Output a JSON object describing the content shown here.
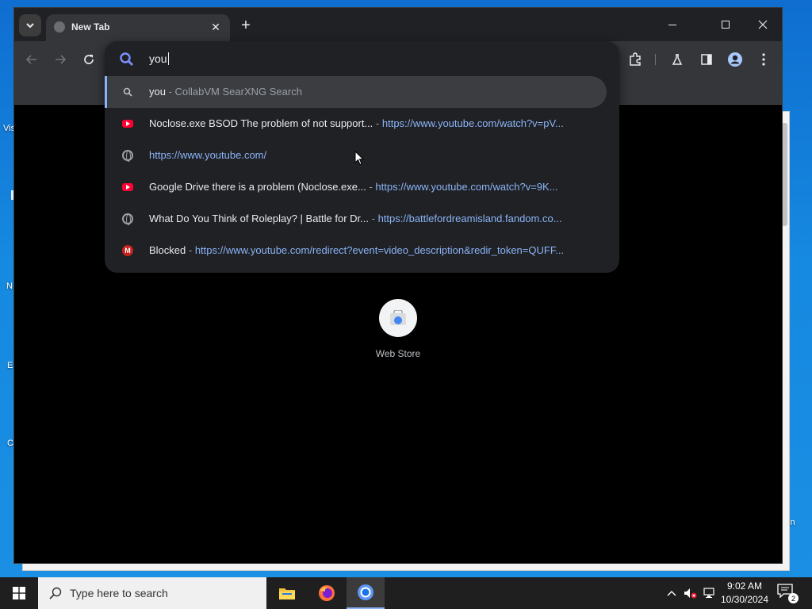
{
  "desktop": {
    "labels": [
      "Vis",
      "N",
      "E",
      "C",
      "in"
    ]
  },
  "browser": {
    "tab_title": "New Tab",
    "omnibox_text": "you",
    "suggestions": [
      {
        "kind": "search",
        "main": "you",
        "sep": " - ",
        "sub": "CollabVM SearXNG Search",
        "url": ""
      },
      {
        "kind": "youtube",
        "main": "Noclose.exe BSOD The problem of not support...",
        "sep": " - ",
        "sub": "",
        "url": "https://www.youtube.com/watch?v=pV..."
      },
      {
        "kind": "globe",
        "main": "",
        "sep": "",
        "sub": "",
        "url": "https://www.youtube.com/"
      },
      {
        "kind": "youtube",
        "main": "Google Drive there is a problem (Noclose.exe...",
        "sep": " - ",
        "sub": "",
        "url": "https://www.youtube.com/watch?v=9K..."
      },
      {
        "kind": "globe",
        "main": "What Do You Think of Roleplay? | Battle for Dr...",
        "sep": " - ",
        "sub": "",
        "url": "https://battlefordreamisland.fandom.co..."
      },
      {
        "kind": "gmail",
        "main": "Blocked",
        "sep": " - ",
        "sub": "",
        "url": "https://www.youtube.com/redirect?event=video_description&redir_token=QUFF..."
      }
    ],
    "shortcut_label": "Web Store"
  },
  "taskbar": {
    "search_placeholder": "Type here to search",
    "time": "9:02 AM",
    "date": "10/30/2024",
    "notification_count": "2"
  },
  "colors": {
    "accent": "#8ab4f8",
    "omnibox_bg": "#202124",
    "toolbar_bg": "#35363a"
  }
}
